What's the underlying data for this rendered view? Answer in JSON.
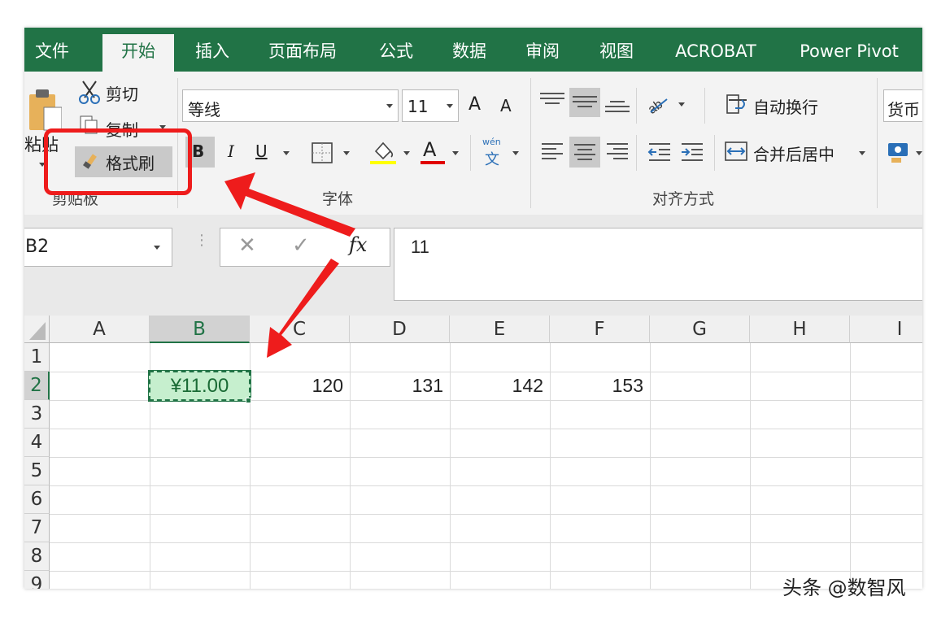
{
  "tabs": [
    {
      "label": "文件"
    },
    {
      "label": "开始"
    },
    {
      "label": "插入"
    },
    {
      "label": "页面布局"
    },
    {
      "label": "公式"
    },
    {
      "label": "数据"
    },
    {
      "label": "审阅"
    },
    {
      "label": "视图"
    },
    {
      "label": "ACROBAT"
    },
    {
      "label": "Power Pivot"
    }
  ],
  "clipboard": {
    "paste_label": "粘贴",
    "cut_label": "剪切",
    "copy_label": "复制",
    "format_painter_label": "格式刷",
    "group_label": "剪贴板"
  },
  "font": {
    "name": "等线",
    "size": "11",
    "bold": "B",
    "italic": "I",
    "underline": "U",
    "font_color_glyph": "A",
    "phonetic_glyph_top": "wén",
    "phonetic_glyph_bottom": "文",
    "grow_glyph": "A",
    "shrink_glyph": "A",
    "group_label": "字体",
    "fill_color": "#ffff00",
    "text_color": "#e00000"
  },
  "alignment": {
    "wrap_label": "自动换行",
    "merge_label": "合并后居中",
    "group_label": "对齐方式"
  },
  "number": {
    "format": "货币"
  },
  "formula_bar": {
    "name_box": "B2",
    "fx": "fx",
    "content": "11"
  },
  "sheet": {
    "columns": [
      "A",
      "B",
      "C",
      "D",
      "E",
      "F",
      "G",
      "H",
      "I"
    ],
    "rows": [
      "1",
      "2",
      "3",
      "4",
      "5",
      "6",
      "7",
      "8",
      "9"
    ],
    "selected_cell": "B2",
    "row2": {
      "B": "¥11.00",
      "C": "120",
      "D": "131",
      "E": "142",
      "F": "153"
    }
  },
  "watermark": "头条 @数智风",
  "colors": {
    "accent": "#217346",
    "annotation": "#ee1c1c",
    "selected_fill": "#c6efce"
  }
}
